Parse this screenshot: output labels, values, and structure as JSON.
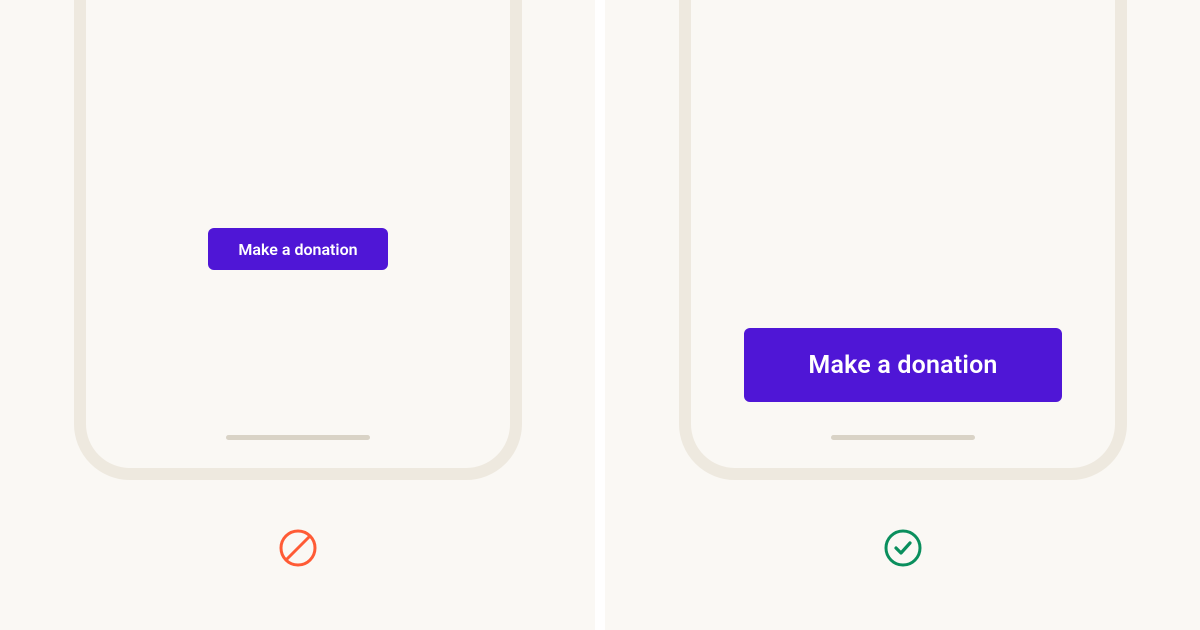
{
  "colors": {
    "button_bg": "#4f16d6",
    "button_text": "#ffffff",
    "panel_bg": "#faf8f4",
    "phone_border": "#eee9df",
    "home_indicator": "#d9d3c6",
    "error": "#ff5b35",
    "success": "#0a8f5d"
  },
  "bad": {
    "button_label": "Make a donation",
    "status": "incorrect"
  },
  "good": {
    "button_label": "Make a donation",
    "status": "correct"
  }
}
